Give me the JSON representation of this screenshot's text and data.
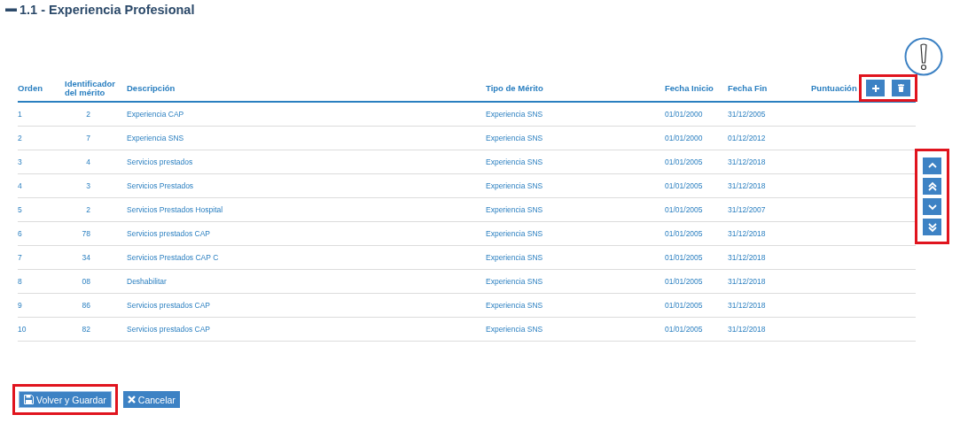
{
  "section": {
    "title": "1.1 - Experiencia Profesional",
    "expanded": true
  },
  "table": {
    "columns": [
      "Orden",
      "Identificador del mérito",
      "Descripción",
      "Tipo de Mérito",
      "Fecha Inicio",
      "Fecha Fin",
      "Puntuación"
    ],
    "toolbar": {
      "highlighted": true
    },
    "rows": [
      {
        "orden": "1",
        "id": "2",
        "descripcion": "Experiencia CAP",
        "tipo": "Experiencia SNS",
        "inicio": "01/01/2000",
        "fin": "31/12/2005"
      },
      {
        "orden": "2",
        "id": "7",
        "descripcion": "Experiencia SNS",
        "tipo": "Experiencia SNS",
        "inicio": "01/01/2000",
        "fin": "01/12/2012"
      },
      {
        "orden": "3",
        "id": "4",
        "descripcion": "Servicios prestados",
        "tipo": "Experiencia SNS",
        "inicio": "01/01/2005",
        "fin": "31/12/2018"
      },
      {
        "orden": "4",
        "id": "3",
        "descripcion": "Servicios Prestados",
        "tipo": "Experiencia SNS",
        "inicio": "01/01/2005",
        "fin": "31/12/2018"
      },
      {
        "orden": "5",
        "id": "2",
        "descripcion": "Servicios Prestados Hospital",
        "tipo": "Experiencia SNS",
        "inicio": "01/01/2005",
        "fin": "31/12/2007"
      },
      {
        "orden": "6",
        "id": "78",
        "descripcion": "Servicios prestados CAP",
        "tipo": "Experiencia SNS",
        "inicio": "01/01/2005",
        "fin": "31/12/2018"
      },
      {
        "orden": "7",
        "id": "34",
        "descripcion": "Servicios Prestados CAP C",
        "tipo": "Experiencia SNS",
        "inicio": "01/01/2005",
        "fin": "31/12/2018"
      },
      {
        "orden": "8",
        "id": "08",
        "descripcion": "Deshabilitar",
        "tipo": "Experiencia SNS",
        "inicio": "01/01/2005",
        "fin": "31/12/2018"
      },
      {
        "orden": "9",
        "id": "86",
        "descripcion": "Servicios prestados CAP",
        "tipo": "Experiencia SNS",
        "inicio": "01/01/2005",
        "fin": "31/12/2018"
      },
      {
        "orden": "10",
        "id": "82",
        "descripcion": "Servicios prestados CAP",
        "tipo": "Experiencia SNS",
        "inicio": "01/01/2005",
        "fin": "31/12/2018"
      }
    ]
  },
  "move_buttons": {
    "highlighted": true
  },
  "footer": {
    "save": {
      "label": "Volver y Guardar",
      "highlighted": true
    },
    "cancel": {
      "label": "Cancelar"
    }
  }
}
